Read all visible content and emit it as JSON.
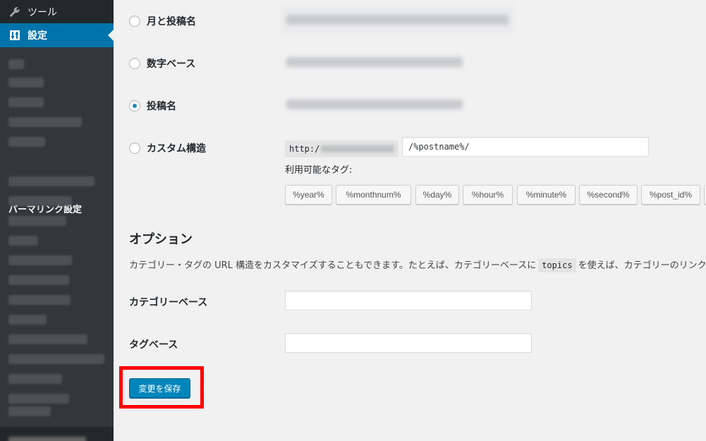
{
  "sidebar": {
    "tools_label": "ツール",
    "settings_label": "設定",
    "current_submenu": "パーマリンク設定"
  },
  "permalink": {
    "options": [
      {
        "label": "月と投稿名",
        "checked": false
      },
      {
        "label": "数字ベース",
        "checked": false
      },
      {
        "label": "投稿名",
        "checked": true
      },
      {
        "label": "カスタム構造",
        "checked": false
      }
    ],
    "base_prefix": "http:/",
    "structure_value": "/%postname%/",
    "tags_label": "利用可能なタグ:",
    "tags": [
      "%year%",
      "%monthnum%",
      "%day%",
      "%hour%",
      "%minute%",
      "%second%",
      "%post_id%"
    ]
  },
  "options": {
    "heading": "オプション",
    "desc_before": "カテゴリー・タグの URL 構造をカスタマイズすることもできます。たとえば、カテゴリーベースに",
    "desc_code": "topics",
    "desc_after": "を使えば、カテゴリーのリンク",
    "category_base_label": "カテゴリーベース",
    "tag_base_label": "タグベース",
    "category_base_value": "",
    "tag_base_value": ""
  },
  "save_button_label": "変更を保存",
  "colors": {
    "accent": "#0073aa",
    "button": "#0085ba",
    "highlight": "#ff0000"
  }
}
